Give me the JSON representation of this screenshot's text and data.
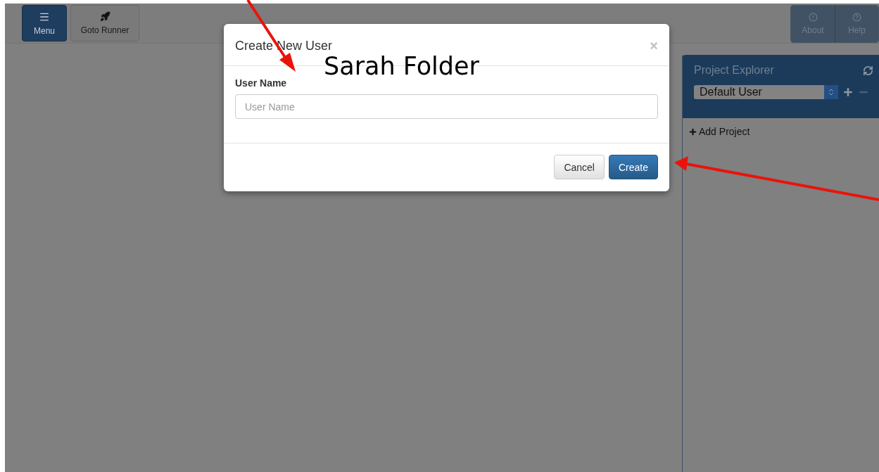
{
  "toolbar": {
    "left_buttons": [
      {
        "label": "Menu",
        "kind": "primary"
      },
      {
        "label": "Goto Runner",
        "kind": "default"
      }
    ],
    "right_buttons": [
      {
        "label": "About"
      },
      {
        "label": "Help"
      }
    ]
  },
  "project_explorer": {
    "title": "Project Explorer",
    "user_select": {
      "value": "Default User"
    },
    "add_project": "Add Project"
  },
  "modal": {
    "title": "Create New User",
    "close": "×",
    "field_label": "User Name",
    "field": {
      "placeholder": "User Name"
    },
    "buttons": [
      {
        "label": "Cancel",
        "kind": "default"
      },
      {
        "label": "Create",
        "kind": "primary"
      }
    ]
  },
  "annotation": {
    "text": "Sarah Folder"
  }
}
